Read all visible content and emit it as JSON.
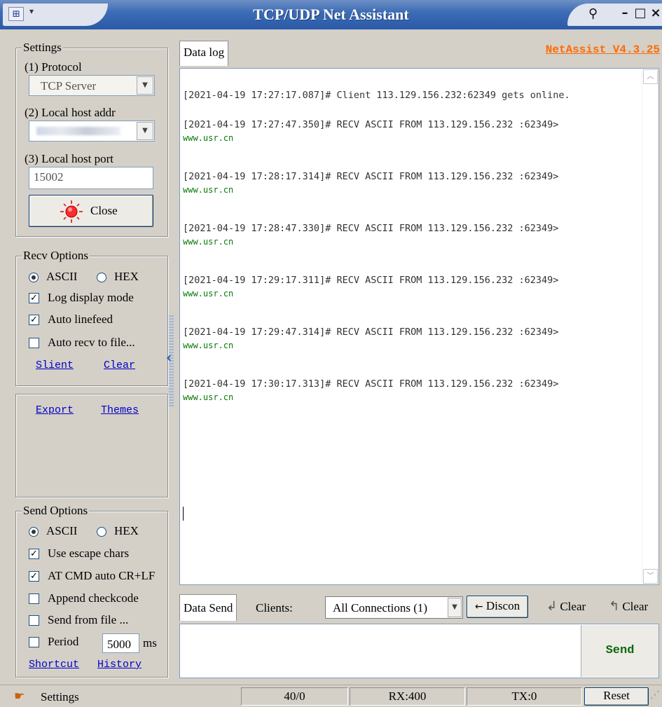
{
  "window": {
    "title": "TCP/UDP Net Assistant",
    "app_icon": "network-icon",
    "menu_arrow": "▾",
    "pin_glyph": "⊣",
    "min_glyph": "–",
    "max_glyph": "□",
    "close_glyph": "×"
  },
  "settings": {
    "group_title": "Settings",
    "protocol_label": "(1) Protocol",
    "protocol_value": "TCP Server",
    "host_label": "(2) Local host addr",
    "port_label": "(3) Local host port",
    "port_value": "15002",
    "close_button": "Close"
  },
  "recv_options": {
    "group_title": "Recv Options",
    "ascii": "ASCII",
    "hex": "HEX",
    "ascii_selected": true,
    "log_display": "Log display mode",
    "auto_linefeed": "Auto linefeed",
    "auto_recv_file": "Auto recv to file...",
    "silent_link": "Slient",
    "clear_link": "Clear"
  },
  "misc_links": {
    "export": "Export",
    "themes": "Themes"
  },
  "send_options": {
    "group_title": "Send Options",
    "ascii": "ASCII",
    "hex": "HEX",
    "ascii_selected": true,
    "use_escape": "Use escape chars",
    "at_cmd": "AT CMD auto CR+LF",
    "append_checkcode": "Append checkcode",
    "send_from_file": "Send from file ...",
    "period": "Period",
    "period_value": "5000",
    "period_unit": "ms",
    "shortcut_link": "Shortcut",
    "history_link": "History"
  },
  "data_log": {
    "tab_label": "Data log",
    "version": "NetAssist V4.3.25",
    "entries": [
      {
        "header": "[2021-04-19 17:27:17.087]# Client 113.129.156.232:62349 gets online.",
        "data": ""
      },
      {
        "header": "[2021-04-19 17:27:47.350]# RECV ASCII FROM 113.129.156.232 :62349>",
        "data": "www.usr.cn"
      },
      {
        "header": "[2021-04-19 17:28:17.314]# RECV ASCII FROM 113.129.156.232 :62349>",
        "data": "www.usr.cn"
      },
      {
        "header": "[2021-04-19 17:28:47.330]# RECV ASCII FROM 113.129.156.232 :62349>",
        "data": "www.usr.cn"
      },
      {
        "header": "[2021-04-19 17:29:17.311]# RECV ASCII FROM 113.129.156.232 :62349>",
        "data": "www.usr.cn"
      },
      {
        "header": "[2021-04-19 17:29:47.314]# RECV ASCII FROM 113.129.156.232 :62349>",
        "data": "www.usr.cn"
      },
      {
        "header": "[2021-04-19 17:30:17.313]# RECV ASCII FROM 113.129.156.232 :62349>",
        "data": "www.usr.cn"
      }
    ]
  },
  "data_send": {
    "tab_label": "Data Send",
    "clients_label": "Clients:",
    "connections_value": "All Connections (1)",
    "disconnect_button": "Discon",
    "clear1": "Clear",
    "clear2": "Clear",
    "send_button": "Send"
  },
  "status_bar": {
    "settings_label": "Settings",
    "counter": "40/0",
    "rx": "RX:400",
    "tx": "TX:0",
    "reset": "Reset"
  }
}
